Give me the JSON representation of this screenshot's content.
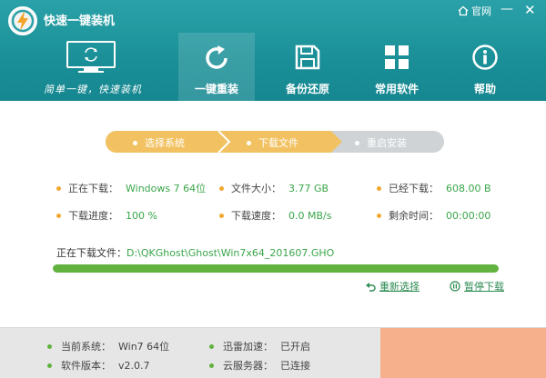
{
  "app": {
    "title": "快速一键装机",
    "slogan": "简单一键，快速装机"
  },
  "window": {
    "home_label": "官网",
    "minimize": "—",
    "close": "✕"
  },
  "nav": [
    {
      "label": "一键重装",
      "icon": "refresh-icon",
      "active": true
    },
    {
      "label": "备份还原",
      "icon": "save-icon",
      "active": false
    },
    {
      "label": "常用软件",
      "icon": "apps-grid-icon",
      "active": false
    },
    {
      "label": "帮助",
      "icon": "info-icon",
      "active": false
    }
  ],
  "steps": [
    {
      "label": "选择系统",
      "state": "done"
    },
    {
      "label": "下载文件",
      "state": "active"
    },
    {
      "label": "重启安装",
      "state": "pending"
    }
  ],
  "download": {
    "current_label": "正在下载：",
    "current_value": "Windows 7 64位",
    "size_label": "文件大小：",
    "size_value": "3.77 GB",
    "done_label": "已经下载：",
    "done_value": "608.00 B",
    "progress_label": "下载进度：",
    "progress_value": "100 %",
    "speed_label": "下载速度：",
    "speed_value": "0.0 MB/s",
    "remain_label": "剩余时间：",
    "remain_value": "00:00:00",
    "file_label": "正在下载文件：",
    "file_value": "D:\\QKGhost\\Ghost\\Win7x64_201607.GHO",
    "progress_fraction": 1.0
  },
  "actions": {
    "reselect": "重新选择",
    "pause": "暂停下载"
  },
  "footer": {
    "system_label": "当前系统：",
    "system_value": "Win7 64位",
    "accel_label": "迅雷加速：",
    "accel_value": "已开启",
    "version_label": "软件版本：",
    "version_value": "v2.0.7",
    "server_label": "云服务器：",
    "server_value": "已连接"
  },
  "colors": {
    "header": "#1a8f97",
    "step_active": "#f2c262",
    "step_pending": "#cfd3d6",
    "green": "#61b23e",
    "accent_text": "#3aa64a"
  }
}
